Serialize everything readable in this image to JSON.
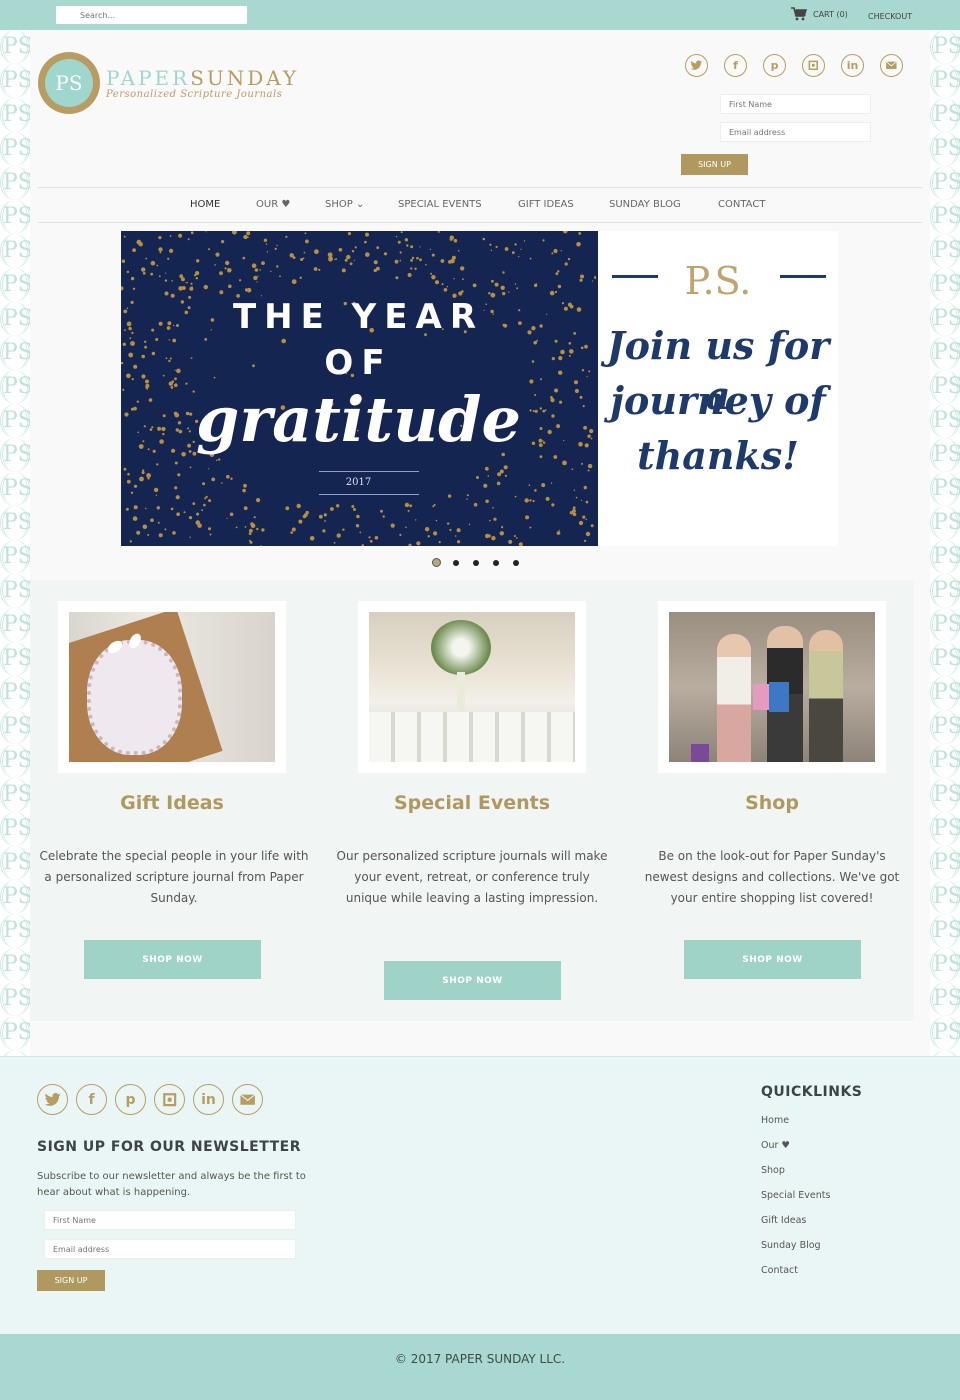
{
  "topbar": {
    "search_placeholder": "Search...",
    "cart_label": "CART (0)",
    "checkout_label": "CHECKOUT"
  },
  "brand": {
    "seal_monogram": "PS",
    "name_part1": "PAPER",
    "name_part2": "SUNDAY",
    "tagline": "Personalized Scripture Journals"
  },
  "social": [
    "twitter",
    "facebook",
    "pinterest",
    "instagram",
    "linkedin",
    "email"
  ],
  "header_signup": {
    "first_name_placeholder": "First Name",
    "email_placeholder": "Email address",
    "button": "SIGN UP"
  },
  "nav": [
    {
      "label": "HOME",
      "active": true
    },
    {
      "label": "OUR ♥"
    },
    {
      "label": "SHOP ⌄"
    },
    {
      "label": "SPECIAL EVENTS"
    },
    {
      "label": "GIFT IDEAS"
    },
    {
      "label": "SUNDAY BLOG"
    },
    {
      "label": "CONTACT"
    }
  ],
  "slider": {
    "line1": "THE YEAR",
    "line2": "OF",
    "line3": "gratitude",
    "year": "2017",
    "ps": "P.S.",
    "script1": "Join us for a",
    "script2": "journey of",
    "script3": "thanks!",
    "slide_count": 5,
    "active_slide": 1
  },
  "features": [
    {
      "image": "gift-package-photo",
      "title": "Gift Ideas",
      "desc": "Celebrate the special people in your life with a personalized scripture journal from Paper Sunday.",
      "button": "SHOP NOW"
    },
    {
      "image": "event-banquet-photo",
      "title": "Special Events",
      "desc": "Our personalized scripture journals will make your event, retreat, or conference truly unique while leaving a lasting impression.",
      "button": "SHOP NOW"
    },
    {
      "image": "women-shopping-photo",
      "title": "Shop",
      "desc": "Be on the look-out for Paper Sunday's newest designs and collections. We've got your entire shopping list covered!",
      "button": "SHOP NOW"
    }
  ],
  "footer": {
    "newsletter_title": "SIGN UP FOR OUR NEWSLETTER",
    "newsletter_desc": "Subscribe to our newsletter and always be the first to hear about what is happening.",
    "first_name_placeholder": "First Name",
    "email_placeholder": "Email address",
    "button": "SIGN UP",
    "quicklinks_title": "QUICKLINKS",
    "quicklinks": [
      "Home",
      "Our ♥",
      "Shop",
      "Special Events",
      "Gift Ideas",
      "Sunday Blog",
      "Contact"
    ],
    "copyright": "© 2017 PAPER SUNDAY LLC."
  },
  "colors": {
    "teal": "#a8d8cf",
    "gold": "#b0995e",
    "navy": "#152552"
  }
}
